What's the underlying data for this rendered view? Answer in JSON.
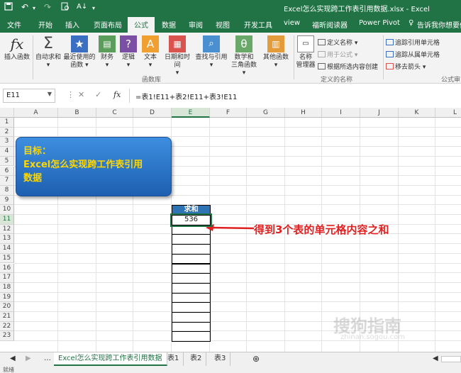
{
  "titlebar": {
    "title": "Excel怎么实现跨工作表引用数据.xlsx - Excel"
  },
  "tabs": [
    {
      "label": "文件"
    },
    {
      "label": "开始"
    },
    {
      "label": "插入"
    },
    {
      "label": "页面布局"
    },
    {
      "label": "公式"
    },
    {
      "label": "数据"
    },
    {
      "label": "审阅"
    },
    {
      "label": "视图"
    },
    {
      "label": "开发工具"
    },
    {
      "label": "view"
    },
    {
      "label": "福昕阅读器"
    },
    {
      "label": "Power Pivot"
    },
    {
      "label": "告诉我你想要做"
    }
  ],
  "ribbon": {
    "insert_fn": "插入函数",
    "autosum": "自动求和",
    "recent": [
      "最近使用的",
      "函数"
    ],
    "finance": "财务",
    "logic": "逻辑",
    "text": "文本",
    "datetime": "日期和时间",
    "lookup": "查找与引用",
    "math": [
      "数学和",
      "三角函数"
    ],
    "other": "其他函数",
    "group_fnlib": "函数库",
    "name_mgr": [
      "名称",
      "管理器"
    ],
    "define_name": "定义名称",
    "use_formula": "用于公式",
    "create_sel": "根据所选内容创建",
    "group_names": "定义的名称",
    "trace_prec": "追踪引用单元格",
    "trace_dep": "追踪从属单元格",
    "remove_arrows": "移去箭头",
    "group_audit": "公式审"
  },
  "formulabar": {
    "namebox": "E11",
    "fx": "fx",
    "formula": "=表1!E11+表2!E11+表3!E11"
  },
  "grid": {
    "columns": [
      "A",
      "B",
      "C",
      "D",
      "E",
      "F",
      "G",
      "H",
      "I",
      "J",
      "K",
      "L"
    ],
    "rows": [
      "1",
      "2",
      "3",
      "4",
      "5",
      "6",
      "7",
      "8",
      "9",
      "10",
      "11",
      "12",
      "13",
      "14",
      "15",
      "16",
      "17",
      "18",
      "19",
      "20",
      "21",
      "22",
      "23"
    ],
    "header_cell": "求和",
    "value_cell": "536"
  },
  "goal": {
    "line1": "目标：",
    "line2": "Excel怎么实现跨工作表引用",
    "line3": "数据"
  },
  "annotation": "得到3个表的单元格内容之和",
  "watermark": {
    "main": "搜狗指南",
    "sub": "zhinan.sogou.com"
  },
  "sheets": [
    {
      "label": "Excel怎么实现跨工作表引用数据"
    },
    {
      "label": "表1"
    },
    {
      "label": "表2"
    },
    {
      "label": "表3"
    }
  ],
  "status": "就绪",
  "colors": {
    "excel_green": "#217346",
    "header_blue": "#2e74b5",
    "goal_text": "#ffd700",
    "annotation_red": "#e02020"
  }
}
